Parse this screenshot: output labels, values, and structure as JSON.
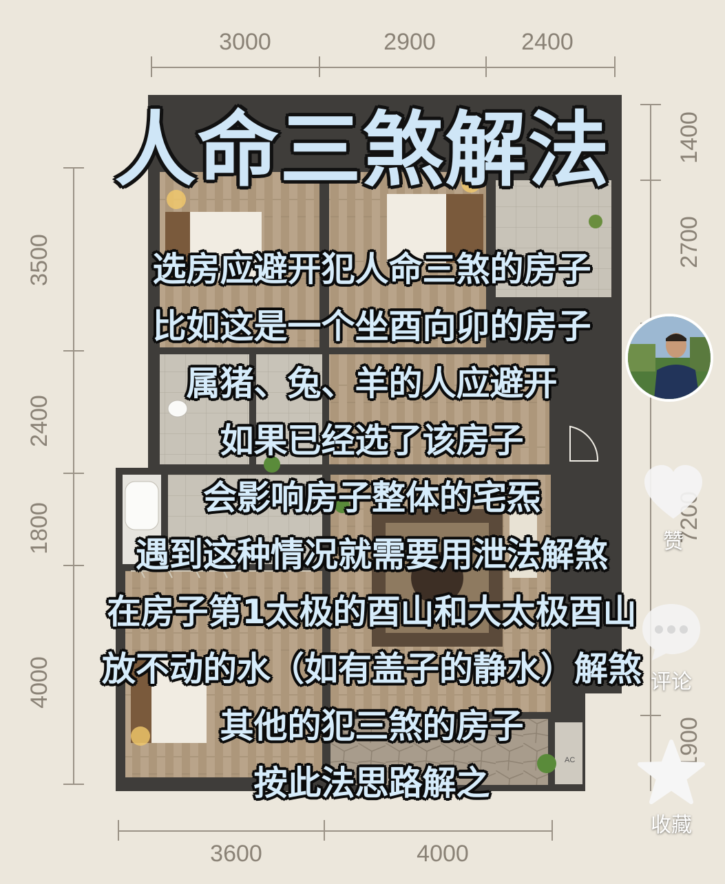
{
  "title": "人命三煞解法",
  "dimensions": {
    "top": [
      "3000",
      "2900",
      "2400"
    ],
    "bottom": [
      "3600",
      "4000"
    ],
    "left": [
      "3500",
      "2400",
      "1800",
      "4000"
    ],
    "right": [
      "1400",
      "2700",
      "7200",
      "1900"
    ]
  },
  "plan_labels": {
    "ac": "AC"
  },
  "lines": [
    "选房应避开犯人命三煞的房子",
    "比如这是一个坐酉向卯的房子",
    "属猪、兔、羊的人应避开",
    "如果已经选了该房子",
    "会影响房子整体的宅炁",
    "遇到这种情况就需要用泄法解煞",
    "在房子第1太极的酉山和大太极酉山",
    "放不动的水（如有盖子的静水）解煞",
    "其他的犯三煞的房子",
    "按此法思路解之"
  ],
  "sidebar": {
    "like_label": "赞",
    "comment_label": "评论",
    "favorite_label": "收藏"
  },
  "icons": {
    "like": "heart-icon",
    "comment": "comment-bubble-icon",
    "favorite": "star-icon",
    "avatar": "author-avatar"
  },
  "colors": {
    "background": "#ece7dc",
    "title_fill": "#cfe6f7",
    "text_fill": "#d6ecfb",
    "outline": "#111111"
  }
}
